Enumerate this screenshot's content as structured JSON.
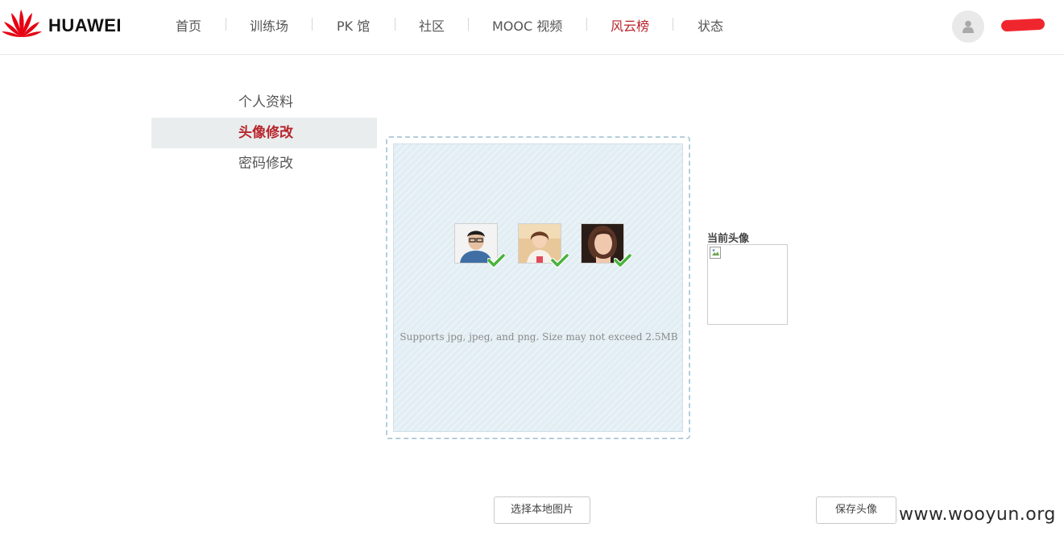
{
  "brand": {
    "name": "HUAWEI",
    "logo_color": "#e60012"
  },
  "nav": {
    "items": [
      {
        "label": "首页"
      },
      {
        "label": "训练场"
      },
      {
        "label": "PK 馆"
      },
      {
        "label": "社区"
      },
      {
        "label": "MOOC 视频"
      },
      {
        "label": "风云榜",
        "active": true
      },
      {
        "label": "状态"
      }
    ],
    "active_color": "#b8242c"
  },
  "user": {
    "avatar_icon": "user-silhouette-icon",
    "name_redacted": true,
    "redaction_color": "#f0262f"
  },
  "side_menu": {
    "items": [
      {
        "label": "个人资料"
      },
      {
        "label": "头像修改",
        "active": true
      },
      {
        "label": "密码修改"
      }
    ]
  },
  "upload": {
    "hint": "Supports jpg, jpeg, and png. Size may not exceed 2.5MB",
    "samples": [
      {
        "icon": "sample-avatar-man"
      },
      {
        "icon": "sample-avatar-woman-1"
      },
      {
        "icon": "sample-avatar-woman-2"
      }
    ],
    "check_icon": "green-check-icon"
  },
  "current_avatar": {
    "label": "当前头像"
  },
  "buttons": {
    "choose_local": "选择本地图片",
    "save_avatar": "保存头像"
  },
  "watermark": "www.wooyun.org"
}
